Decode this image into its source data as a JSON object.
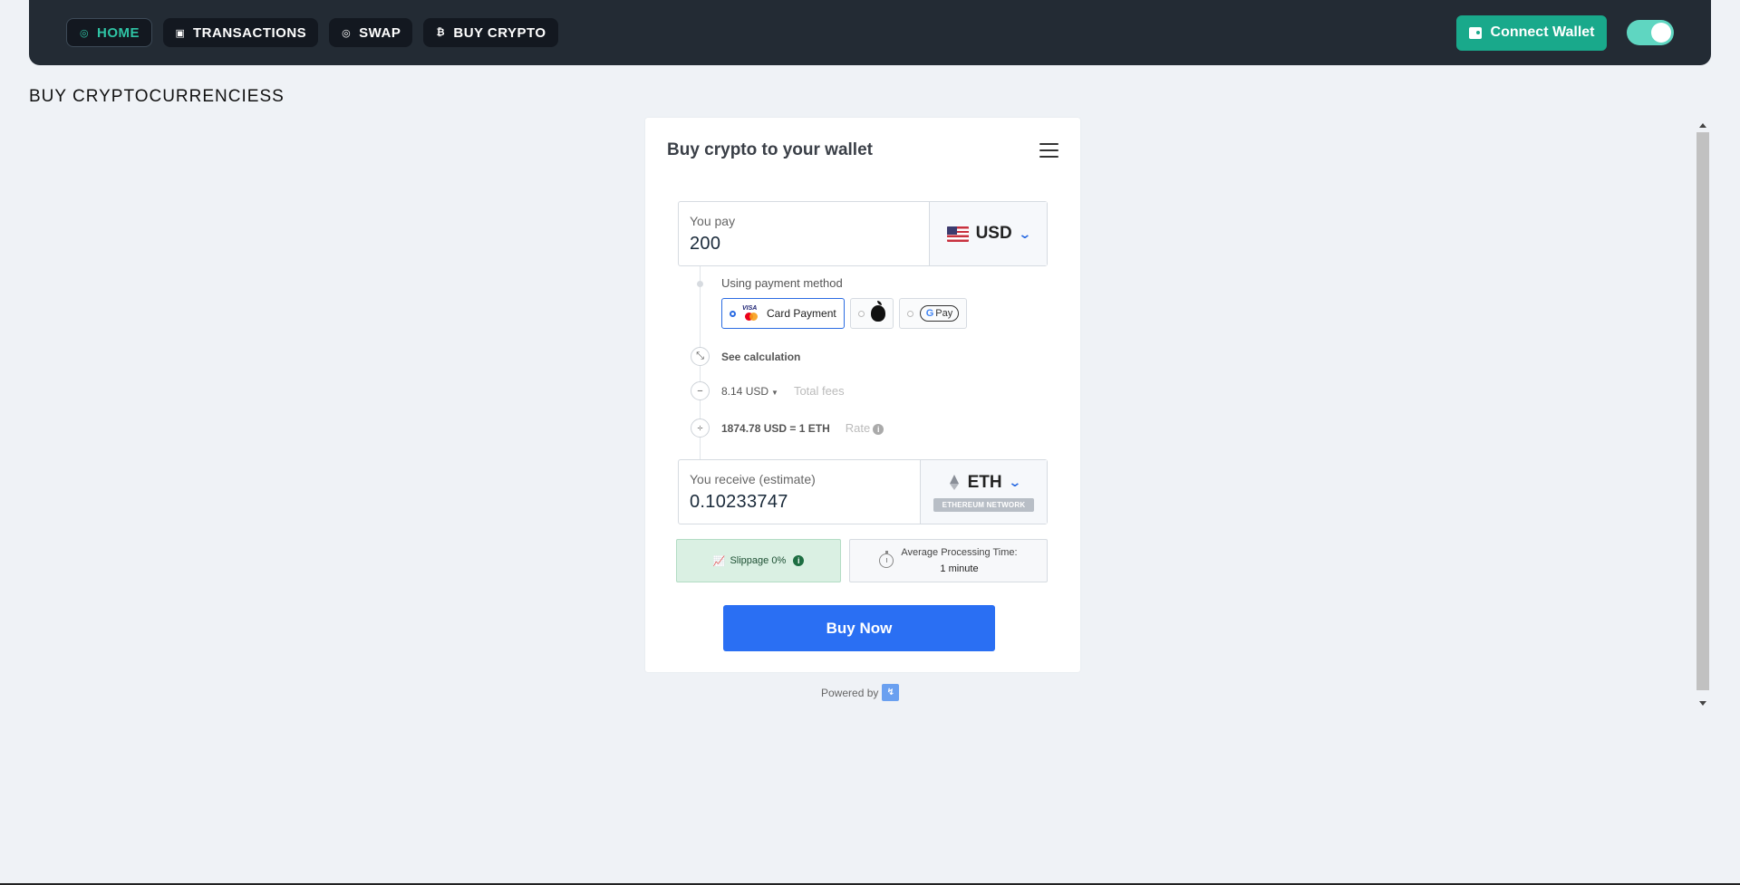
{
  "nav": {
    "items": [
      {
        "label": "HOME",
        "icon": "home-coin-icon",
        "active": true
      },
      {
        "label": "TRANSACTIONS",
        "icon": "wallet-icon",
        "active": false
      },
      {
        "label": "SWAP",
        "icon": "swap-icon",
        "active": false
      },
      {
        "label": "BUY CRYPTO",
        "icon": "bitcoin-icon",
        "active": false
      }
    ],
    "connect_wallet": "Connect Wallet",
    "theme_toggle_on": true
  },
  "page": {
    "title": "BUY CRYPTOCURRENCIESS"
  },
  "widget": {
    "title": "Buy crypto to your wallet",
    "pay": {
      "label": "You pay",
      "amount": "200",
      "currency": "USD"
    },
    "payment_method_label": "Using payment method",
    "payment_methods": [
      {
        "label": "Card Payment",
        "selected": true
      },
      {
        "label": "",
        "selected": false
      },
      {
        "label": "Pay",
        "selected": false
      }
    ],
    "see_calculation": "See calculation",
    "fees_value": "8.14 USD",
    "fees_label": "Total fees",
    "rate_value": "1874.78 USD = 1 ETH",
    "rate_label": "Rate",
    "receive": {
      "label": "You receive (estimate)",
      "amount": "0.10233747",
      "currency": "ETH",
      "network": "ETHEREUM NETWORK"
    },
    "slippage": "Slippage 0%",
    "processing_label": "Average Processing Time:",
    "processing_value": "1 minute",
    "buy_button": "Buy Now"
  },
  "footer": {
    "powered_by": "Powered by"
  },
  "colors": {
    "accent_teal": "#19a98b",
    "primary_blue": "#2a6ff3",
    "navbar_bg": "#232b34"
  }
}
